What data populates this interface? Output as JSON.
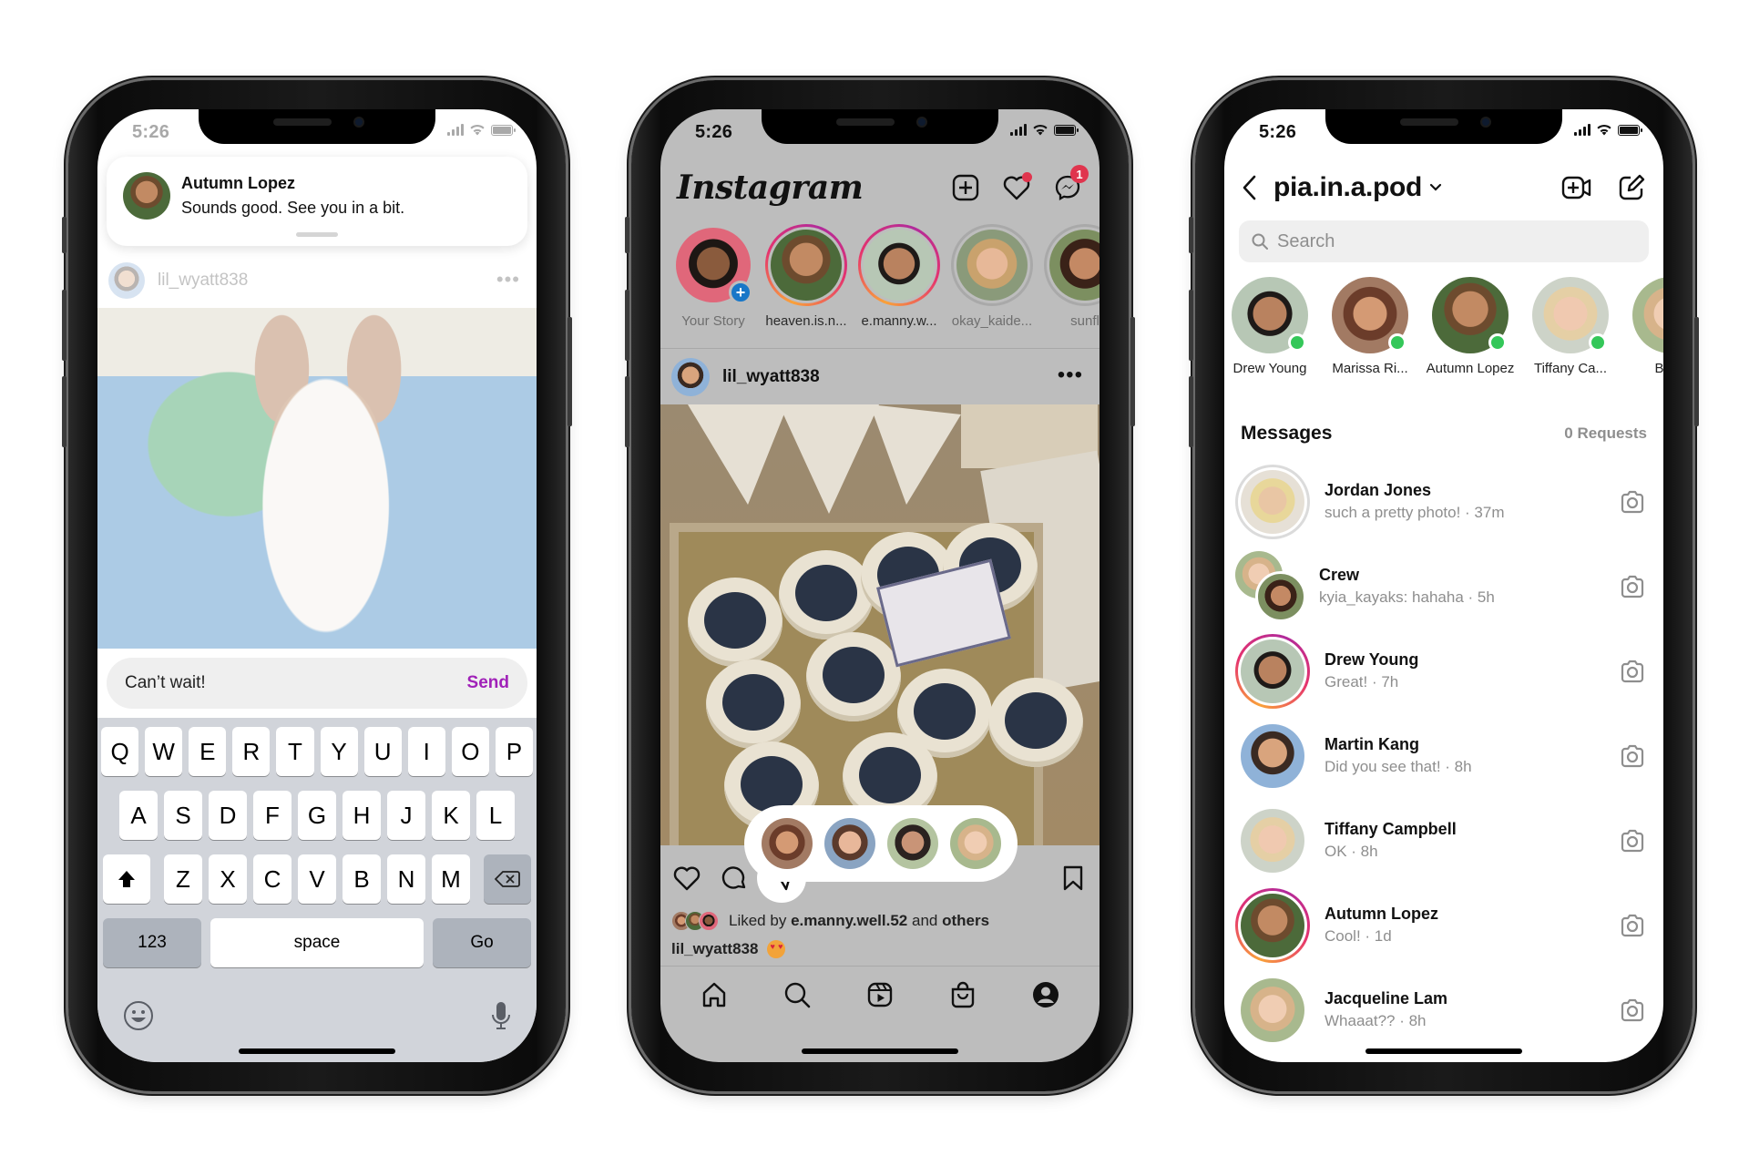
{
  "status_bar": {
    "time": "5:26"
  },
  "phone1": {
    "notification": {
      "sender": "Autumn Lopez",
      "message": "Sounds good. See you in a bit."
    },
    "faded_post": {
      "username": "lil_wyatt838",
      "more": "•••"
    },
    "reply": {
      "text": "Can’t wait!",
      "send_label": "Send"
    },
    "keyboard": {
      "row1": [
        "Q",
        "W",
        "E",
        "R",
        "T",
        "Y",
        "U",
        "I",
        "O",
        "P"
      ],
      "row2": [
        "A",
        "S",
        "D",
        "F",
        "G",
        "H",
        "J",
        "K",
        "L"
      ],
      "row3": [
        "Z",
        "X",
        "C",
        "V",
        "B",
        "N",
        "M"
      ],
      "numbers_label": "123",
      "space_label": "space",
      "go_label": "Go"
    }
  },
  "phone2": {
    "app_title": "Instagram",
    "messenger_badge": "1",
    "stories": [
      {
        "label": "Your Story",
        "own": true
      },
      {
        "label": "heaven.is.n...",
        "ring": true
      },
      {
        "label": "e.manny.w...",
        "ring": true
      },
      {
        "label": "okay_kaide...",
        "ring": false
      },
      {
        "label": "sunfl",
        "ring": false
      }
    ],
    "post": {
      "username": "lil_wyatt838",
      "more": "•••",
      "share_recipients": 4,
      "liked_by_prefix": "Liked by",
      "liked_by_user": "e.manny.well.52",
      "liked_by_and": "and",
      "liked_by_others": "others",
      "caption_user": "lil_wyatt838"
    },
    "tabbar": [
      "home-icon",
      "search-icon",
      "reels-icon",
      "shop-icon",
      "profile-icon"
    ]
  },
  "phone3": {
    "account": "pia.in.a.pod",
    "search_placeholder": "Search",
    "active_users": [
      {
        "name": "Drew Young"
      },
      {
        "name": "Marissa Ri..."
      },
      {
        "name": "Autumn Lopez"
      },
      {
        "name": "Tiffany Ca..."
      },
      {
        "name": "Brian"
      }
    ],
    "messages_title": "Messages",
    "requests_label": "0 Requests",
    "threads": [
      {
        "name": "Jordan Jones",
        "preview": "such a pretty photo! · 37m",
        "ring": "gray"
      },
      {
        "name": "Crew",
        "preview": "kyia_kayaks: hahaha · 5h",
        "group": true
      },
      {
        "name": "Drew Young",
        "preview": "Great! · 7h",
        "ring": "story"
      },
      {
        "name": "Martin Kang",
        "preview": "Did you see that! · 8h"
      },
      {
        "name": "Tiffany Campbell",
        "preview": "OK · 8h"
      },
      {
        "name": "Autumn Lopez",
        "preview": "Cool! · 1d",
        "ring": "story"
      },
      {
        "name": "Jacqueline Lam",
        "preview": "Whaaat?? · 8h"
      }
    ]
  },
  "colors": {
    "send_accent": "#a021b8",
    "online": "#34c759",
    "badge": "#e0354e",
    "story_add": "#1877c8"
  }
}
